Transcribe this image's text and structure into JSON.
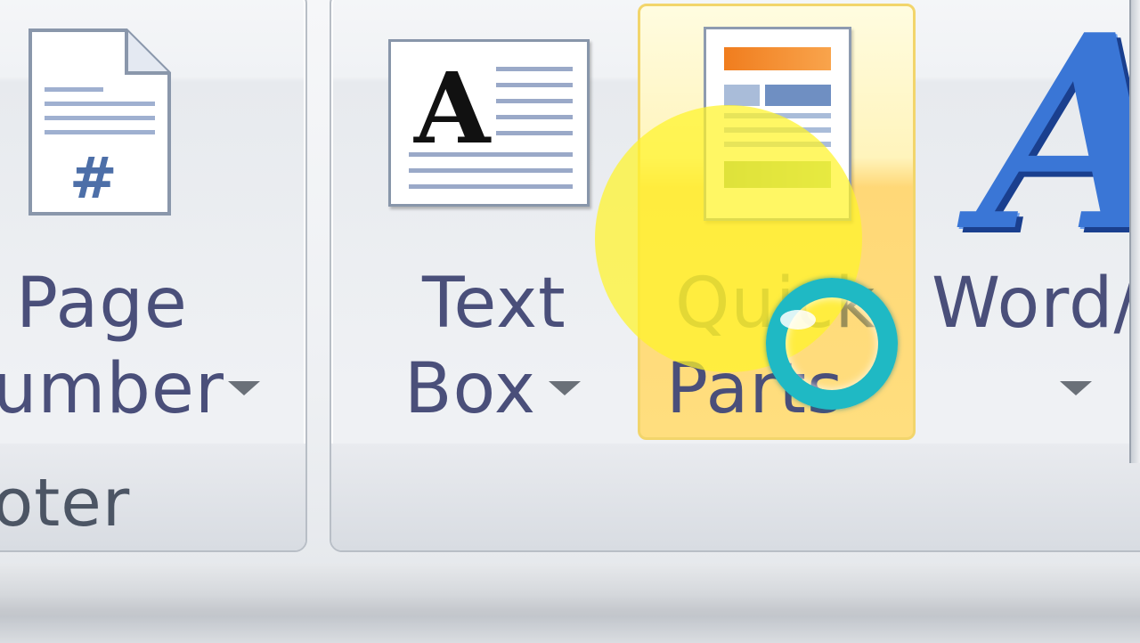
{
  "left_group": {
    "label": "oter",
    "page_number": {
      "line1": "Page",
      "line2": "umber",
      "icon_glyph": "#",
      "icon": "page-number-icon"
    }
  },
  "right_group": {
    "text_box": {
      "line1": "Text",
      "line2": "Box",
      "icon_glyph": "A",
      "icon": "text-box-icon"
    },
    "quick_parts": {
      "line1": "Quick",
      "line2": "Parts",
      "icon": "quick-parts-icon",
      "state": "hovered"
    },
    "wordart": {
      "line1": "Word/",
      "icon_glyph": "A",
      "icon": "wordart-icon"
    }
  },
  "colors": {
    "label_text": "#4a4f7a",
    "hover_fill": "#ffd877",
    "highlight": "#fff428",
    "busy_ring": "#1fb9c4",
    "wordart_blue": "#3a76d6"
  }
}
